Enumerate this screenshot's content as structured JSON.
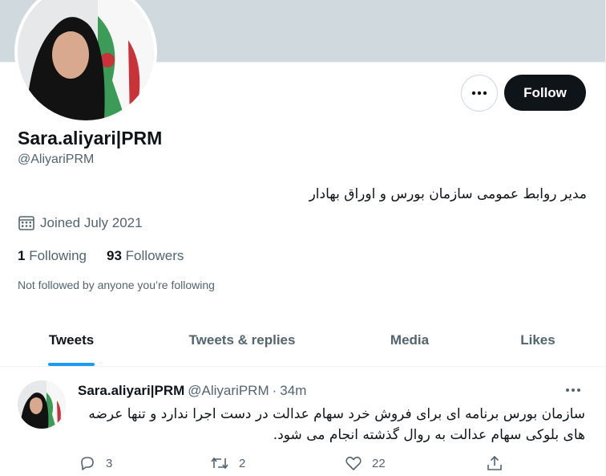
{
  "profile": {
    "display_name": "Sara.aliyari|PRM",
    "handle": "@AliyariPRM",
    "bio": "مدیر روابط عمومی سازمان بورس و اوراق بهادار",
    "joined": "Joined July 2021",
    "following_count": "1",
    "following_label": "Following",
    "followers_count": "93",
    "followers_label": "Followers",
    "not_followed": "Not followed by anyone you’re following"
  },
  "actions": {
    "follow_label": "Follow"
  },
  "tabs": [
    {
      "label": "Tweets",
      "active": true
    },
    {
      "label": "Tweets & replies",
      "active": false
    },
    {
      "label": "Media",
      "active": false
    },
    {
      "label": "Likes",
      "active": false
    }
  ],
  "tweet": {
    "name": "Sara.aliyari|PRM",
    "handle": "@AliyariPRM",
    "separator": "·",
    "time": "34m",
    "text": "سازمان بورس برنامه ای برای فروش خرد سهام عدالت در دست اجرا ندارد و تنها عرضه های بلوکی سهام عدالت به روال گذشته انجام می شود.",
    "replies": "3",
    "retweets": "2",
    "likes": "22"
  },
  "icons": {
    "more": "more-dots-icon",
    "calendar": "calendar-icon",
    "reply": "reply-icon",
    "retweet": "retweet-icon",
    "like": "heart-icon",
    "share": "share-icon"
  },
  "colors": {
    "accent": "#1d9bf0",
    "banner": "#cfd9de",
    "text": "#0f1419",
    "secondary": "#536471"
  }
}
